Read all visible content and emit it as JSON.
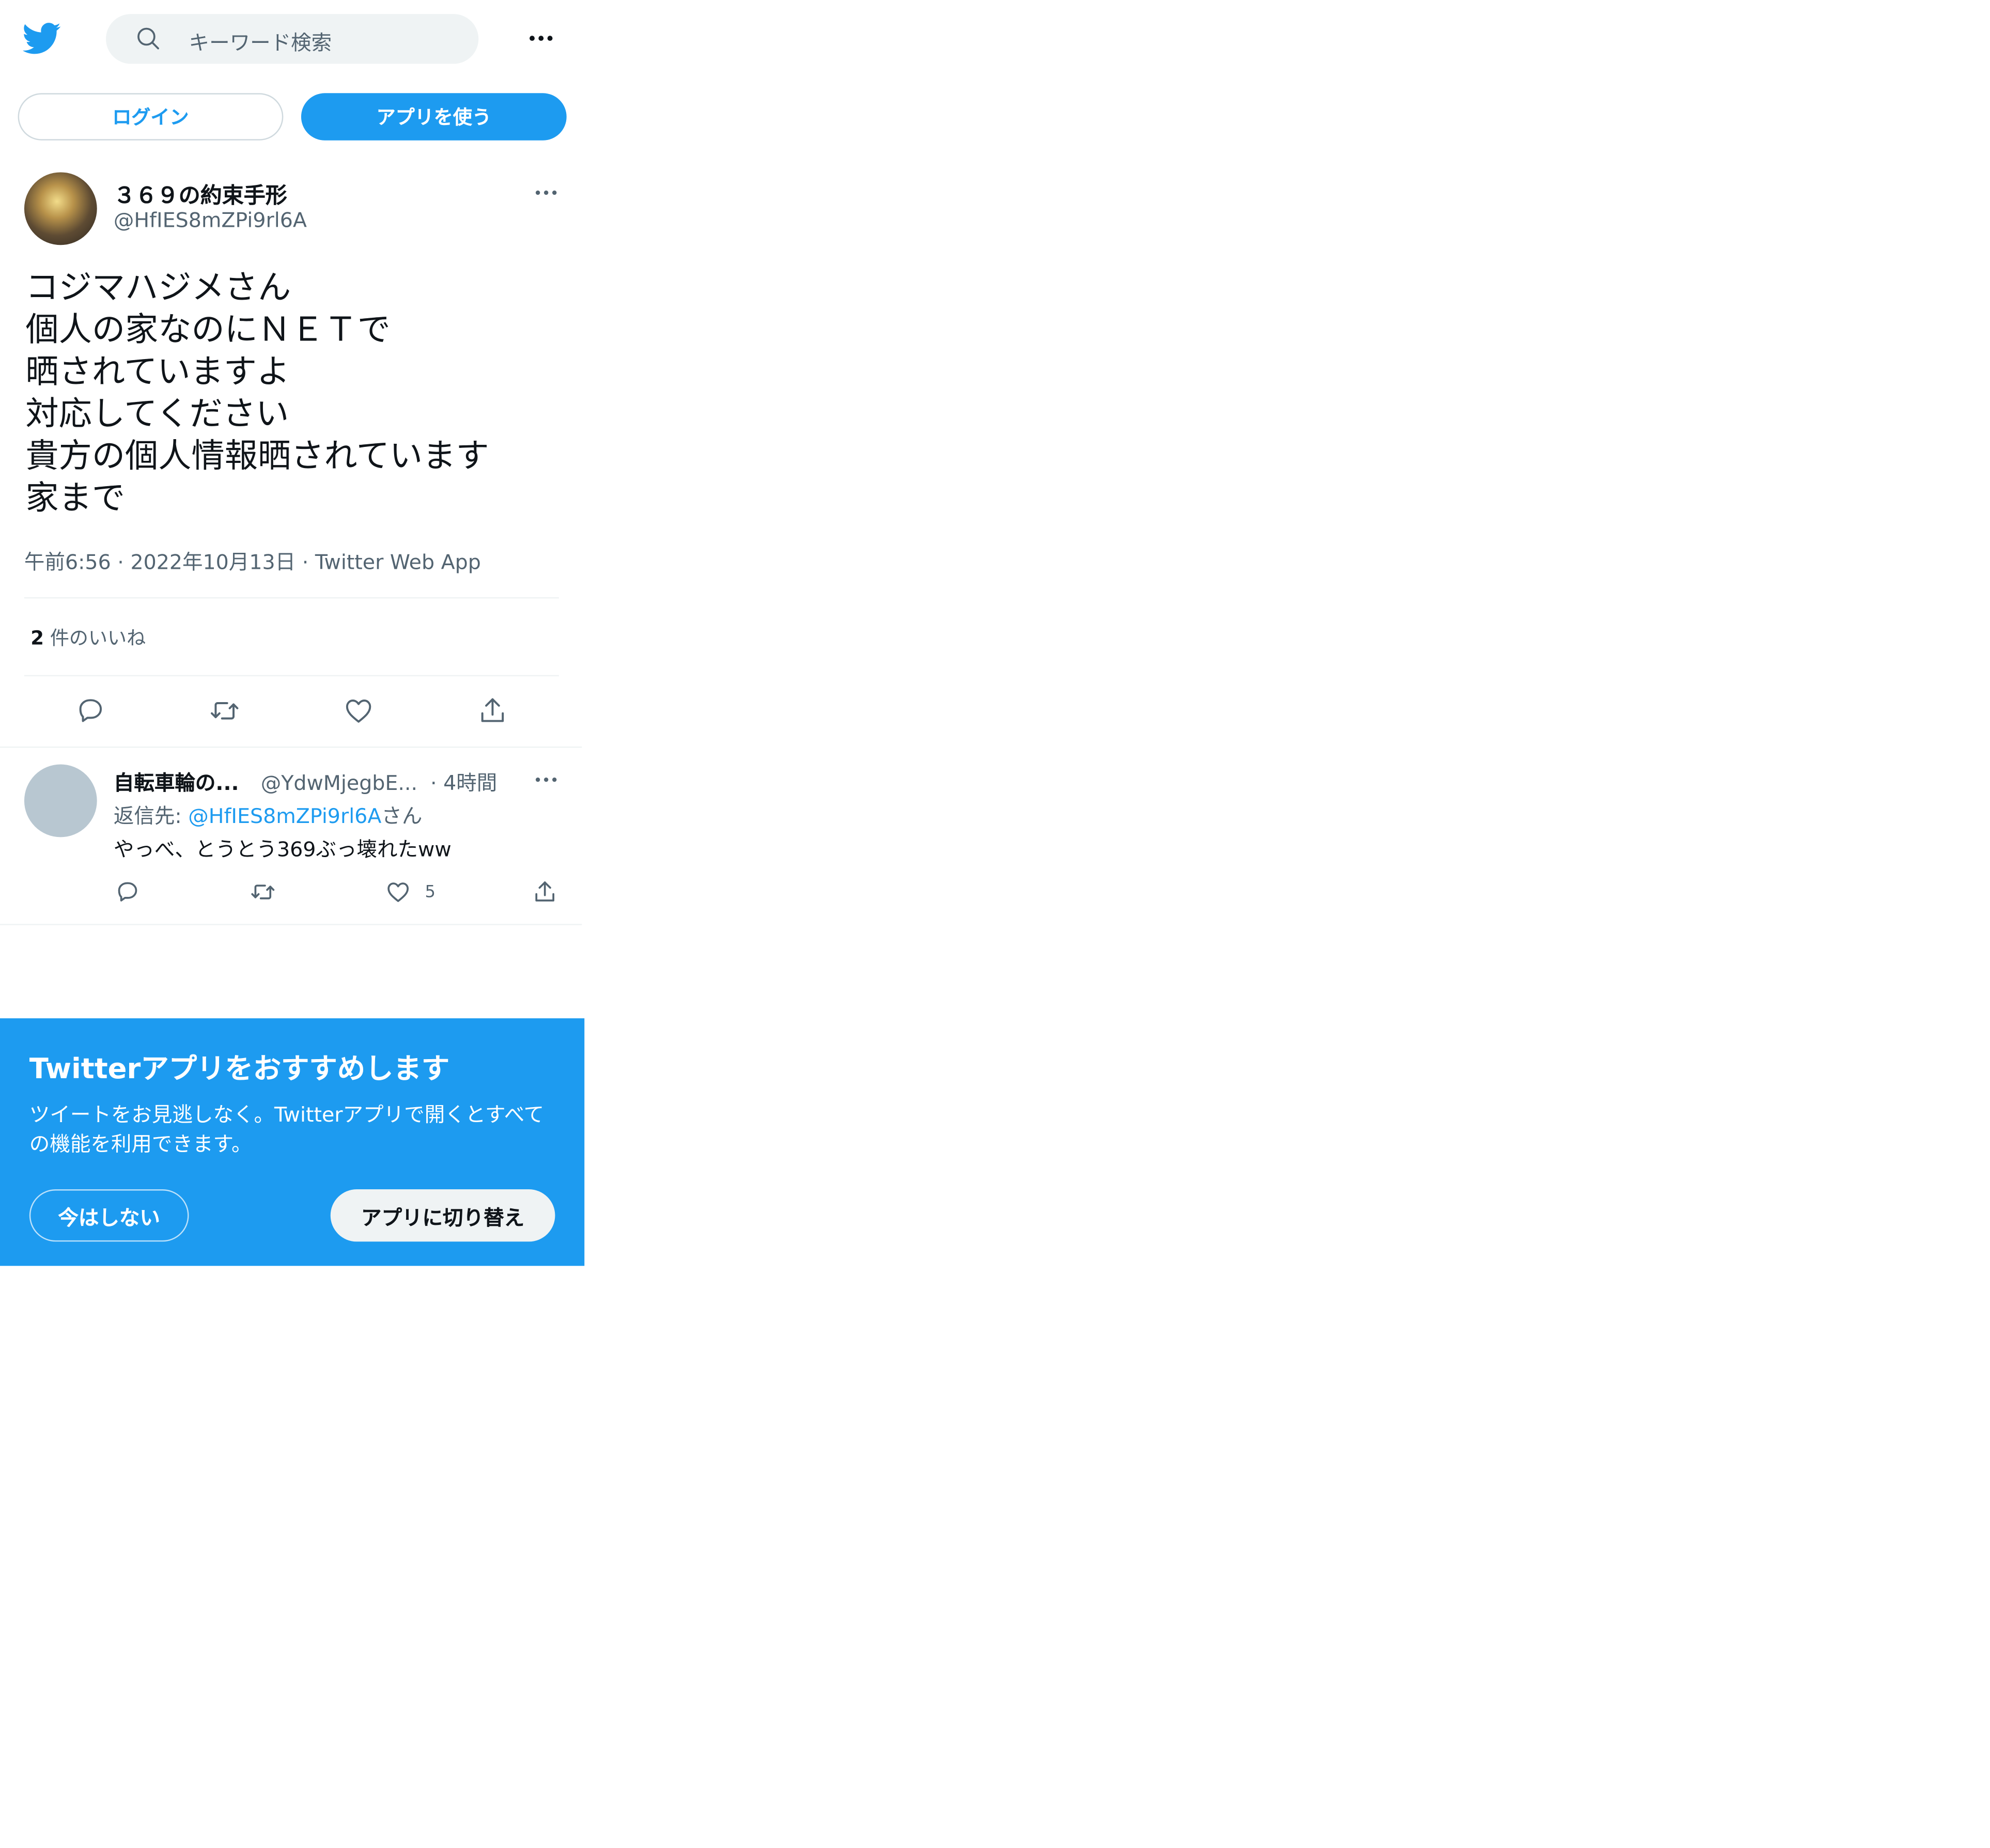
{
  "header": {
    "search_placeholder": "キーワード検索",
    "login_label": "ログイン",
    "use_app_label": "アプリを使う"
  },
  "tweet": {
    "author_name": "３６９の約束手形",
    "author_handle": "@HfIES8mZPi9rl6A",
    "text_lines": [
      "コジマハジメさん",
      "個人の家なのにＮＥＴで",
      "晒されていますよ",
      "対応してください",
      "貴方の個人情報晒されています",
      "家まで"
    ],
    "time": "午前6:56",
    "date": "2022年10月13日",
    "source": "Twitter Web App",
    "likes_count": "2",
    "likes_label": "件のいいね"
  },
  "reply": {
    "author_name": "自転車輪の...",
    "author_handle": "@YdwMjegbE...",
    "time": "4時間",
    "reply_to_prefix": "返信先: ",
    "reply_to_handle": "@HfIES8mZPi9rl6A",
    "reply_to_suffix": "さん",
    "text": "やっべ、とうとう369ぶっ壊れたww",
    "like_count": "5"
  },
  "banner": {
    "title": "Twitterアプリをおすすめします",
    "body": "ツイートをお見逃しなく。Twitterアプリで開くとすべての機能を利用できます。",
    "not_now_label": "今はしない",
    "switch_label": "アプリに切り替え"
  },
  "colors": {
    "brand_blue": "#1d9bf0",
    "text_primary": "#0f1419",
    "text_secondary": "#536471",
    "divider": "#eff3f4",
    "search_bg": "#eff3f4",
    "avatar_placeholder": "#b8c7d1"
  },
  "icons": [
    "twitter-bird-icon",
    "search-icon",
    "more-icon",
    "reply-icon",
    "retweet-icon",
    "like-icon",
    "share-icon"
  ]
}
